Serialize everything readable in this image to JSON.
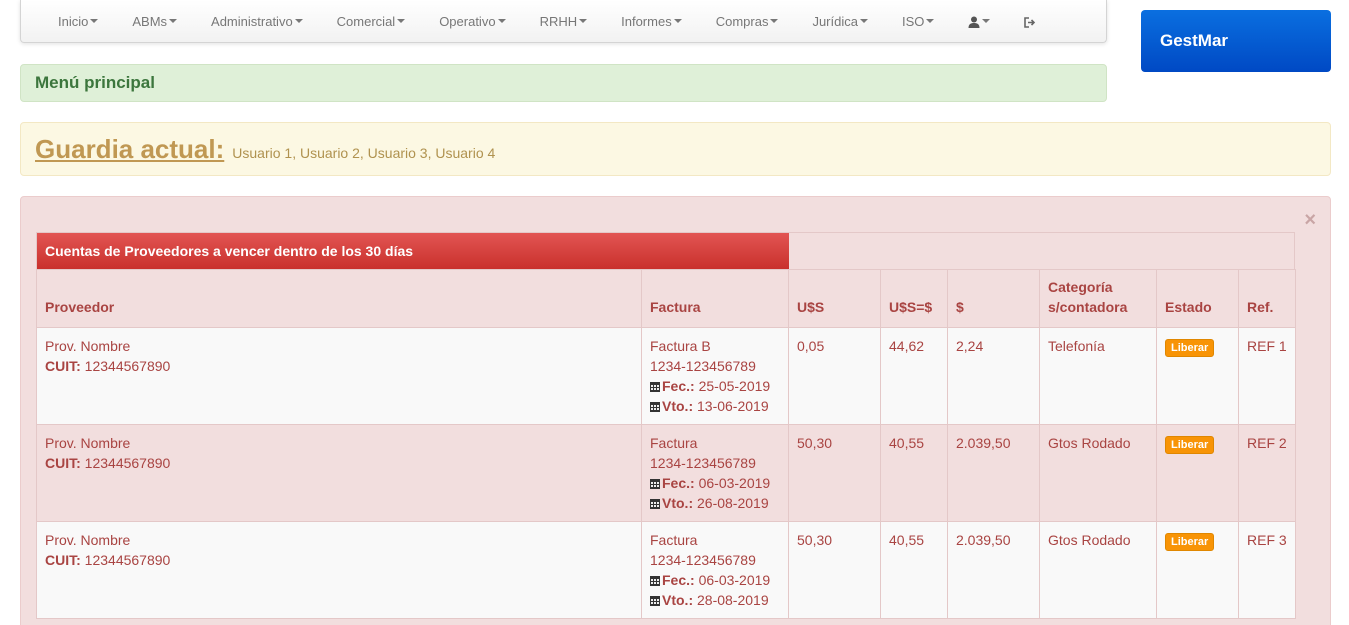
{
  "nav": {
    "items": [
      {
        "label": "Inicio"
      },
      {
        "label": "ABMs"
      },
      {
        "label": "Administrativo"
      },
      {
        "label": "Comercial"
      },
      {
        "label": "Operativo"
      },
      {
        "label": "RRHH"
      },
      {
        "label": "Informes"
      },
      {
        "label": "Compras"
      },
      {
        "label": "Jurídica"
      },
      {
        "label": "ISO"
      }
    ],
    "user_icon": "user-icon",
    "logout_icon": "logout-icon"
  },
  "brand": {
    "name": "GestMar",
    "color": "#0056d2"
  },
  "menu": {
    "title": "Menú principal"
  },
  "guardia": {
    "title": "Guardia actual:",
    "users": "Usuario 1, Usuario 2, Usuario 3, Usuario 4"
  },
  "panel": {
    "close": "×",
    "caption": "Cuentas de Proveedores a vencer dentro de los 30 días",
    "headers": {
      "proveedor": "Proveedor",
      "factura": "Factura",
      "usd": "U$S",
      "usd_ars": "U$S=$",
      "ars": "$",
      "categoria_1": "Categoría",
      "categoria_2": "s/contadora",
      "estado": "Estado",
      "ref": "Ref."
    },
    "labels": {
      "cuit": "CUIT:",
      "fec": "Fec.:",
      "vto": "Vto.:"
    },
    "rows": [
      {
        "proveedor": "Prov. Nombre",
        "cuit": "12344567890",
        "factura_tipo": "Factura B",
        "factura_num": "1234-123456789",
        "fec": "25-05-2019",
        "vto": "13-06-2019",
        "usd": "0,05",
        "usd_ars": "44,62",
        "ars": "2,24",
        "categoria": "Telefonía",
        "estado": "Liberar",
        "ref": "REF 1"
      },
      {
        "proveedor": "Prov. Nombre",
        "cuit": "12344567890",
        "factura_tipo": "Factura",
        "factura_num": "1234-123456789",
        "fec": "06-03-2019",
        "vto": "26-08-2019",
        "usd": "50,30",
        "usd_ars": "40,55",
        "ars": "2.039,50",
        "categoria": "Gtos Rodado",
        "estado": "Liberar",
        "ref": "REF 2"
      },
      {
        "proveedor": "Prov. Nombre",
        "cuit": "12344567890",
        "factura_tipo": "Factura",
        "factura_num": "1234-123456789",
        "fec": "06-03-2019",
        "vto": "28-08-2019",
        "usd": "50,30",
        "usd_ars": "40,55",
        "ars": "2.039,50",
        "categoria": "Gtos Rodado",
        "estado": "Liberar",
        "ref": "REF 3"
      }
    ]
  }
}
